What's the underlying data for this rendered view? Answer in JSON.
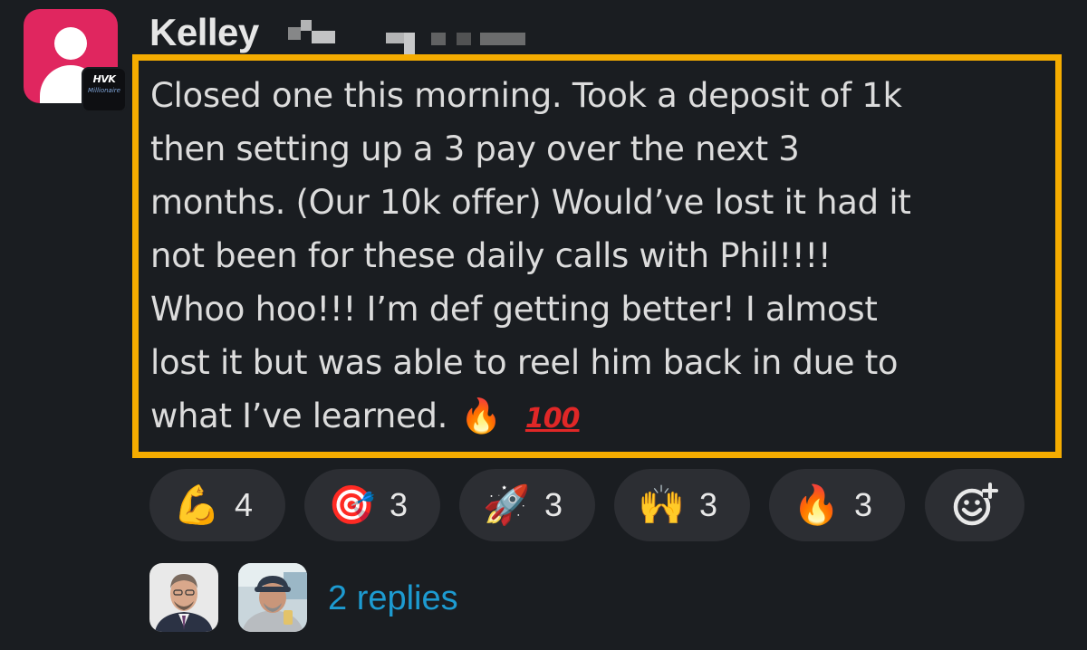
{
  "author": {
    "name": "Kelley",
    "badge_text_top": "HVK",
    "badge_text_bottom": "Millionaire"
  },
  "message": {
    "lines": [
      "Closed one this morning. Took a deposit of 1k",
      "then setting up a 3 pay over the next 3",
      "months. (Our 10k offer) Would’ve lost it had it",
      "not been for these daily calls with Phil!!!!",
      "Whoo hoo!!! I’m def getting better! I almost",
      "lost it but was able to reel him back in due to",
      "what I’ve learned."
    ],
    "trailing_emoji": [
      "fire",
      "hundred-points"
    ],
    "fire_glyph": "🔥",
    "hundred_glyph": "100"
  },
  "highlight_color": "#f5ac00",
  "reactions": [
    {
      "icon": "flexed-biceps",
      "glyph": "💪",
      "count": "4"
    },
    {
      "icon": "direct-hit",
      "glyph": "🎯",
      "count": "3"
    },
    {
      "icon": "rocket",
      "glyph": "🚀",
      "count": "3"
    },
    {
      "icon": "raising-hands",
      "glyph": "🙌",
      "count": "3"
    },
    {
      "icon": "fire",
      "glyph": "🔥",
      "count": "3"
    }
  ],
  "add_reaction_icon": "add-reaction-icon",
  "thread": {
    "replies_label": "2 replies",
    "link_color": "#1d9bd1"
  }
}
